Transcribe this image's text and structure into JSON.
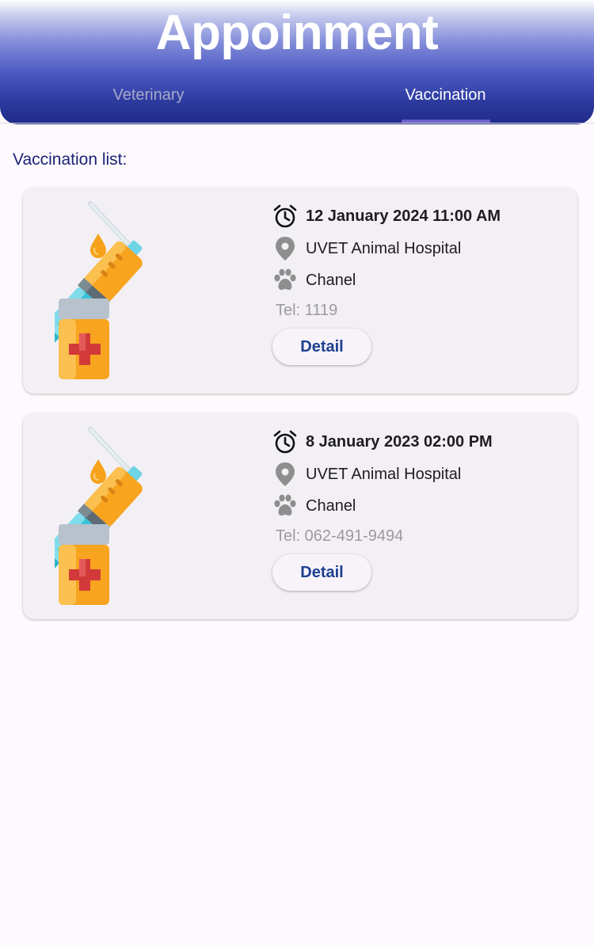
{
  "header": {
    "title": "Appoinment",
    "tabs": [
      {
        "label": "Veterinary",
        "active": false
      },
      {
        "label": "Vaccination",
        "active": true
      }
    ]
  },
  "section_title": "Vaccination list:",
  "colors": {
    "header_gradient_end": "#1f2b88",
    "accent_text": "#1c2377",
    "detail_button_text": "#1c3f8f",
    "tab_indicator": "#6c63c8"
  },
  "appointments": [
    {
      "datetime": "12 January 2024 11:00 AM",
      "location": "UVET Animal Hospital",
      "pet": "Chanel",
      "tel": "Tel: 1119",
      "button": "Detail",
      "image": "syringe-vaccine-illustration"
    },
    {
      "datetime": "8 January 2023 02:00 PM",
      "location": "UVET Animal Hospital",
      "pet": "Chanel",
      "tel": "Tel: 062-491-9494",
      "button": "Detail",
      "image": "syringe-vaccine-illustration"
    }
  ],
  "icons": {
    "time": "alarm-clock-icon",
    "location": "map-pin-icon",
    "pet": "paw-icon"
  }
}
